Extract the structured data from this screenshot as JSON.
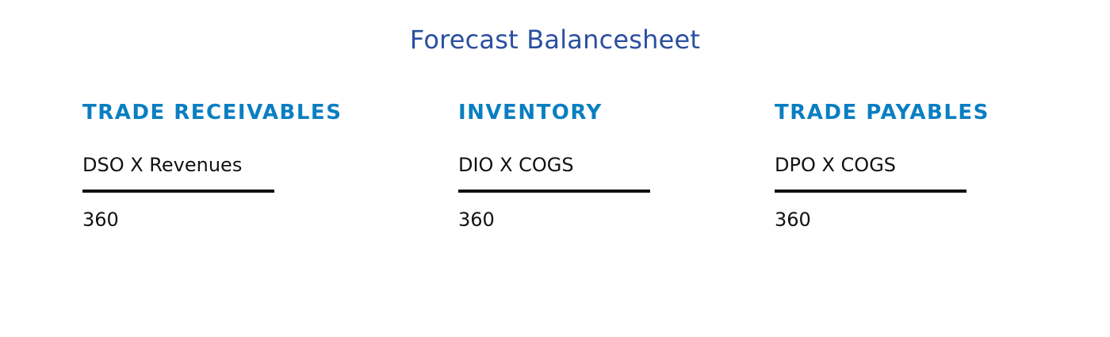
{
  "page": {
    "title": "Forecast Balancesheet"
  },
  "blocks": [
    {
      "heading": "Trade Receivables",
      "numerator": "DSO X Revenues",
      "denominator": "360"
    },
    {
      "heading": "Inventory",
      "numerator": "DIO X COGS",
      "denominator": "360"
    },
    {
      "heading": "Trade Payables",
      "numerator": "DPO X COGS",
      "denominator": "360"
    }
  ],
  "colors": {
    "title": "#2a4fa0",
    "heading": "#0a7ec2",
    "text": "#111111"
  }
}
